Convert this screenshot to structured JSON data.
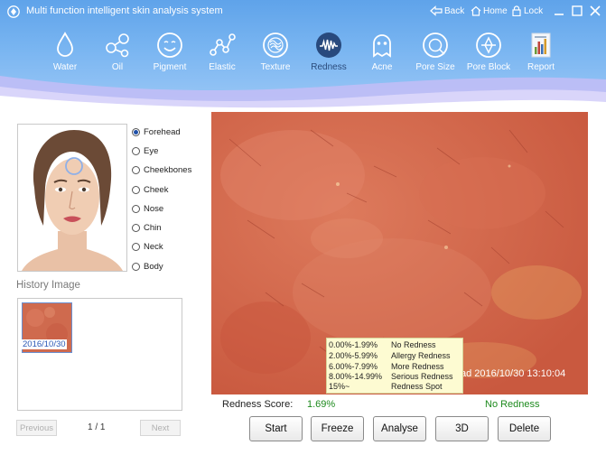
{
  "app": {
    "title": "Multi function intelligent skin analysis system",
    "back_label": "Back",
    "home_label": "Home",
    "lock_label": "Lock"
  },
  "toolbar": {
    "items": [
      {
        "label": "Water",
        "icon": "water-drop-icon"
      },
      {
        "label": "Oil",
        "icon": "oil-molecule-icon"
      },
      {
        "label": "Pigment",
        "icon": "pigment-face-icon"
      },
      {
        "label": "Elastic",
        "icon": "elastic-icon"
      },
      {
        "label": "Texture",
        "icon": "texture-icon"
      },
      {
        "label": "Redness",
        "icon": "redness-icon",
        "active": true
      },
      {
        "label": "Acne",
        "icon": "acne-icon"
      },
      {
        "label": "Pore Size",
        "icon": "pore-size-icon"
      },
      {
        "label": "Pore Block",
        "icon": "pore-block-icon"
      },
      {
        "label": "Report",
        "icon": "report-icon"
      }
    ]
  },
  "regions": {
    "selected": "Forehead",
    "options": [
      "Forehead",
      "Eye",
      "Cheekbones",
      "Cheek",
      "Nose",
      "Chin",
      "Neck",
      "Body"
    ]
  },
  "history": {
    "title": "History Image",
    "items": [
      {
        "date": "2016/10/30"
      }
    ],
    "previous_label": "Previous",
    "next_label": "Next",
    "page_info": "1 / 1"
  },
  "viewer": {
    "timestamp": "ad  2016/10/30 13:10:04"
  },
  "legend": [
    {
      "range": "0.00%-1.99%",
      "desc": "No Redness"
    },
    {
      "range": "2.00%-5.99%",
      "desc": "Allergy Redness"
    },
    {
      "range": "6.00%-7.99%",
      "desc": "More Redness"
    },
    {
      "range": "8.00%-14.99%",
      "desc": "Serious Redness"
    },
    {
      "range": "15%~",
      "desc": "Redness Spot"
    }
  ],
  "score": {
    "label": "Redness Score:",
    "value": "1.69%",
    "status": "No Redness"
  },
  "actions": {
    "start": "Start",
    "freeze": "Freeze",
    "analyse": "Analyse",
    "three_d": "3D",
    "delete": "Delete"
  },
  "colors": {
    "header_blue": "#6aa9ee",
    "wave_purple": "#b9b2f2",
    "score_green": "#1d8a1d",
    "legend_bg": "#fdfbd2",
    "skin": "#d2684d"
  }
}
